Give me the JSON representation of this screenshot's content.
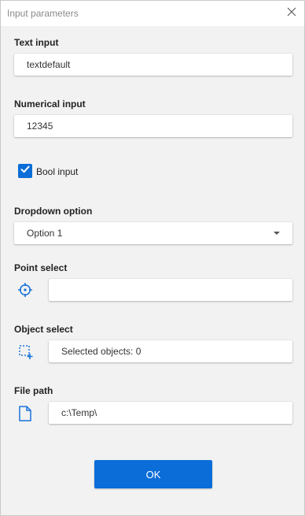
{
  "window": {
    "title": "Input parameters"
  },
  "text_input": {
    "label": "Text input",
    "value": "textdefault"
  },
  "numerical_input": {
    "label": "Numerical input",
    "value": "12345"
  },
  "bool_input": {
    "label": "Bool input",
    "checked": true
  },
  "dropdown": {
    "label": "Dropdown option",
    "selected": "Option 1"
  },
  "point_select": {
    "label": "Point select",
    "value": "",
    "icon": "crosshair-icon"
  },
  "object_select": {
    "label": "Object select",
    "value": "Selected objects: 0",
    "icon": "selection-add-icon"
  },
  "file_path": {
    "label": "File path",
    "value": "c:\\Temp\\",
    "icon": "file-icon"
  },
  "ok_button": {
    "label": "OK"
  },
  "colors": {
    "accent": "#0a6dd8",
    "background": "#f2f2f2",
    "field": "#ffffff"
  }
}
